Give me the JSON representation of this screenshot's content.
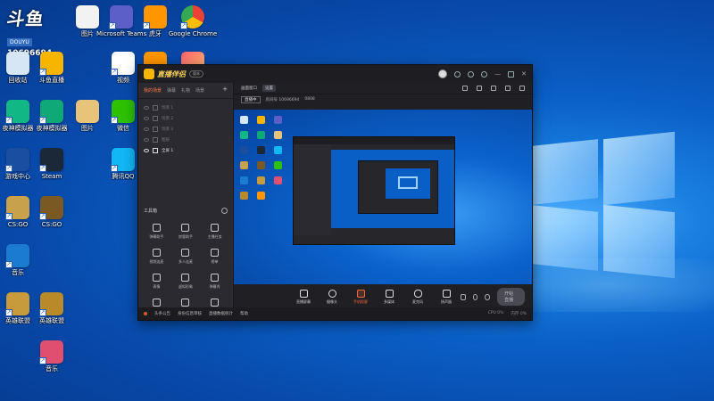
{
  "watermark": {
    "logo_text": "斗鱼",
    "sub_text": "DOUYU",
    "room_number": "10696694"
  },
  "desktop": {
    "icons": [
      {
        "label": "Microsoft Teams",
        "color": "#5b5fc7"
      },
      {
        "label": "回收站",
        "color": "#d6e6f5"
      },
      {
        "label": "斗鱼直播",
        "color": "#f7b500"
      },
      {
        "label": "视频",
        "color": "#ffffff"
      },
      {
        "label": "夜神模拟器",
        "color": "#11b886"
      },
      {
        "label": "图片",
        "color": "#e8c37a"
      },
      {
        "label": "微信",
        "color": "#2dc100"
      },
      {
        "label": "游戏中心",
        "color": "#1a4fa0"
      },
      {
        "label": "Steam",
        "color": "#1b2838"
      },
      {
        "label": "腾讯QQ",
        "color": "#12b7f5"
      },
      {
        "label": "CS:GO",
        "color": "#c8a24a"
      },
      {
        "label": "英雄联盟",
        "color": "#c79b3b"
      },
      {
        "label": "音乐",
        "color": "#e04f6f"
      },
      {
        "label": "Google Chrome",
        "color": "#fbbc05"
      },
      {
        "label": "虎牙",
        "color": "#ff9600"
      }
    ]
  },
  "app": {
    "name": "直播伴侣",
    "version_badge": "版本",
    "left_tabs": [
      "我的场景",
      "弹幕",
      "礼物",
      "场景"
    ],
    "scenes": [
      "场景 1",
      "场景 2",
      "场景 3",
      "图层",
      "全屏 1"
    ],
    "tools_title": "工具箱",
    "tools": [
      "弹幕助手",
      "房管助手",
      "主播任务",
      "视频连麦",
      "多人连麦",
      "榜单",
      "表情",
      "虚拟形象",
      "弹幕秀",
      "更多",
      "礼物",
      "推荐"
    ],
    "right_tabs": [
      "画面窗口",
      "设置"
    ],
    "sub_info": [
      "直播中",
      "房间号 10696694",
      "0808"
    ],
    "controls": [
      "直播屏幕",
      "摄像头",
      "手机投屏",
      "多媒体",
      "麦克风",
      "扬声器"
    ],
    "go_live": "开始直播",
    "status": [
      "头条公告",
      "身份信息审核",
      "直播数据统计",
      "帮助",
      "CPU 0%",
      "内存 0%"
    ]
  }
}
